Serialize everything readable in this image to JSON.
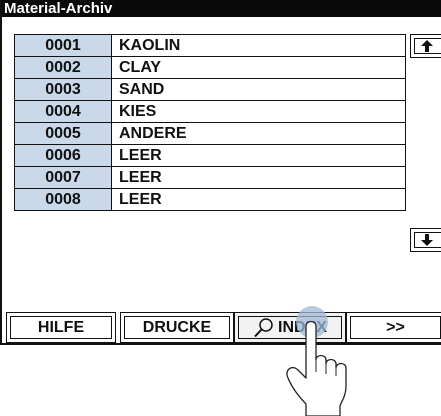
{
  "window": {
    "title": "Material-Archiv"
  },
  "rows": [
    {
      "num": "0001",
      "name": "KAOLIN"
    },
    {
      "num": "0002",
      "name": "CLAY"
    },
    {
      "num": "0003",
      "name": "SAND"
    },
    {
      "num": "0004",
      "name": "KIES"
    },
    {
      "num": "0005",
      "name": "ANDERE"
    },
    {
      "num": "0006",
      "name": "LEER"
    },
    {
      "num": "0007",
      "name": "LEER"
    },
    {
      "num": "0008",
      "name": "LEER"
    }
  ],
  "scroll": {
    "up_icon": "arrow-up-icon",
    "down_icon": "arrow-down-icon"
  },
  "buttons": {
    "help": "HILFE",
    "print": "DRUCKE",
    "index": "INDEX",
    "next": ">>",
    "index_icon": "magnifier-icon"
  },
  "overlay": {
    "icon": "pointing-hand-icon"
  },
  "colors": {
    "number_cell": "#c9d9ea",
    "titlebar": "#0a0a0a",
    "touch": "#9fb8d6"
  }
}
